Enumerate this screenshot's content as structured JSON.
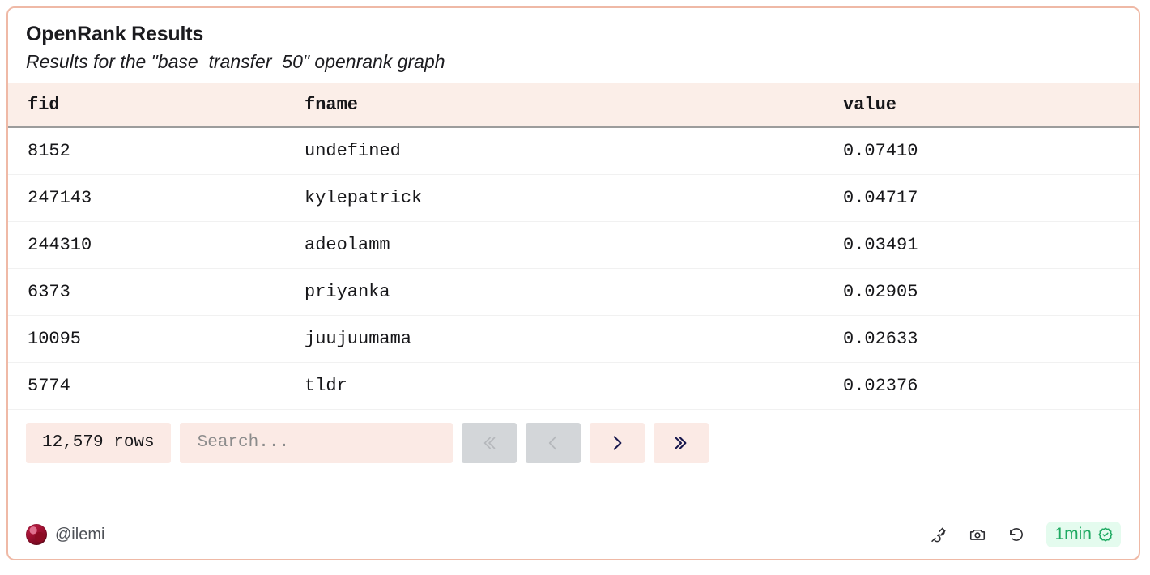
{
  "card": {
    "title": "OpenRank Results",
    "subtitle": "Results for the \"base_transfer_50\" openrank graph"
  },
  "table": {
    "columns": [
      {
        "key": "fid",
        "label": "fid"
      },
      {
        "key": "fname",
        "label": "fname"
      },
      {
        "key": "value",
        "label": "value"
      }
    ],
    "rows": [
      {
        "fid": "8152",
        "fname": "undefined",
        "value": "0.07410"
      },
      {
        "fid": "247143",
        "fname": "kylepatrick",
        "value": "0.04717"
      },
      {
        "fid": "244310",
        "fname": "adeolamm",
        "value": "0.03491"
      },
      {
        "fid": "6373",
        "fname": "priyanka",
        "value": "0.02905"
      },
      {
        "fid": "10095",
        "fname": "juujuumama",
        "value": "0.02633"
      },
      {
        "fid": "5774",
        "fname": "tldr",
        "value": "0.02376"
      }
    ]
  },
  "toolbar": {
    "rows_count_label": "12,579 rows",
    "search_placeholder": "Search...",
    "search_value": "",
    "pagination": [
      {
        "name": "first-page-button",
        "glyph": "«",
        "enabled": false
      },
      {
        "name": "prev-page-button",
        "glyph": "‹",
        "enabled": false
      },
      {
        "name": "next-page-button",
        "glyph": "›",
        "enabled": true
      },
      {
        "name": "last-page-button",
        "glyph": "»",
        "enabled": true
      }
    ]
  },
  "footer": {
    "author_handle": "@ilemi",
    "icons": [
      "plug-icon",
      "camera-icon",
      "refresh-icon"
    ],
    "runtime_label": "1min",
    "runtime_status_icon": "verified-badge-icon"
  },
  "colors": {
    "border": "#efb9a6",
    "header_bg": "#fbeee8",
    "accent_bg": "#fbeae5",
    "chevron_active": "#17174d",
    "disabled_bg": "#d3d6d9",
    "status_green": "#1faa62",
    "status_green_bg": "#e4fbee"
  }
}
